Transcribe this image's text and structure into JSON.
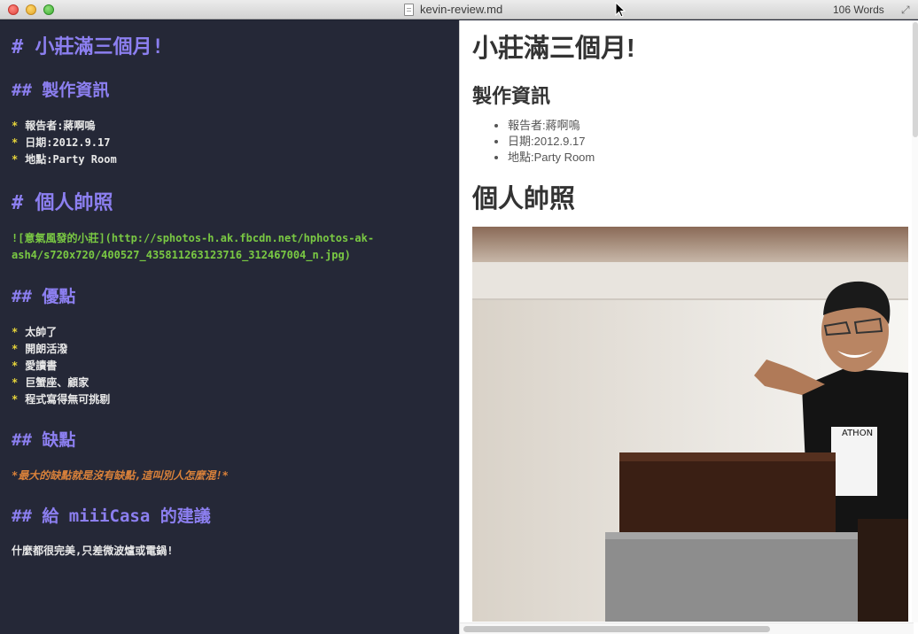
{
  "window": {
    "title": "kevin-review.md",
    "word_count": "106 Words",
    "fullscreen_glyph": "⤢"
  },
  "editor": {
    "h1_title": "# 小莊滿三個月!",
    "h2_info": "## 製作資訊",
    "info_items": [
      "報告者:蔣啊嗚",
      "日期:2012.9.17",
      "地點:Party Room"
    ],
    "bullet": "*",
    "h1_photo": "# 個人帥照",
    "image_markdown": "![意氣風發的小莊](http://sphotos-h.ak.fbcdn.net/hphotos-ak-ash4/s720x720/400527_435811263123716_312467004_n.jpg)",
    "h2_pros": "## 優點",
    "pros_items": [
      "太帥了",
      "開朗活潑",
      "愛讀書",
      "巨蟹座、顧家",
      "程式寫得無可挑剔"
    ],
    "h2_cons": "## 缺點",
    "cons_text": "*最大的缺點就是沒有缺點,這叫別人怎麼混!*",
    "h2_suggest": "## 給 miiiCasa 的建議",
    "suggest_text": "什麼都很完美,只差微波爐或電鍋!"
  },
  "preview": {
    "h1_title": "小莊滿三個月!",
    "h2_info": "製作資訊",
    "info_items": [
      "報告者:蔣啊嗚",
      "日期:2012.9.17",
      "地點:Party Room"
    ],
    "h1_photo": "個人帥照",
    "photo_shirt_text": "ATHON"
  },
  "colors": {
    "editor_bg": "#252837",
    "heading": "#8c7ff0",
    "bullet": "#e6d43a",
    "link": "#7ac943",
    "emphasis": "#d9813a",
    "preview_bg": "#ffffff"
  }
}
